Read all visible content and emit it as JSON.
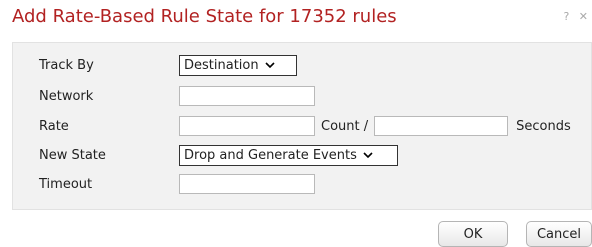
{
  "dialog": {
    "title": "Add Rate-Based Rule State for 17352 rules",
    "help_label": "?",
    "close_label": "✕"
  },
  "form": {
    "track_by": {
      "label": "Track By",
      "value": "Destination"
    },
    "network": {
      "label": "Network",
      "value": ""
    },
    "rate": {
      "label": "Rate",
      "count_value": "",
      "count_label": "Count /",
      "seconds_value": "",
      "seconds_label": "Seconds"
    },
    "new_state": {
      "label": "New State",
      "value": "Drop and Generate Events"
    },
    "timeout": {
      "label": "Timeout",
      "value": ""
    }
  },
  "buttons": {
    "ok": "OK",
    "cancel": "Cancel"
  }
}
